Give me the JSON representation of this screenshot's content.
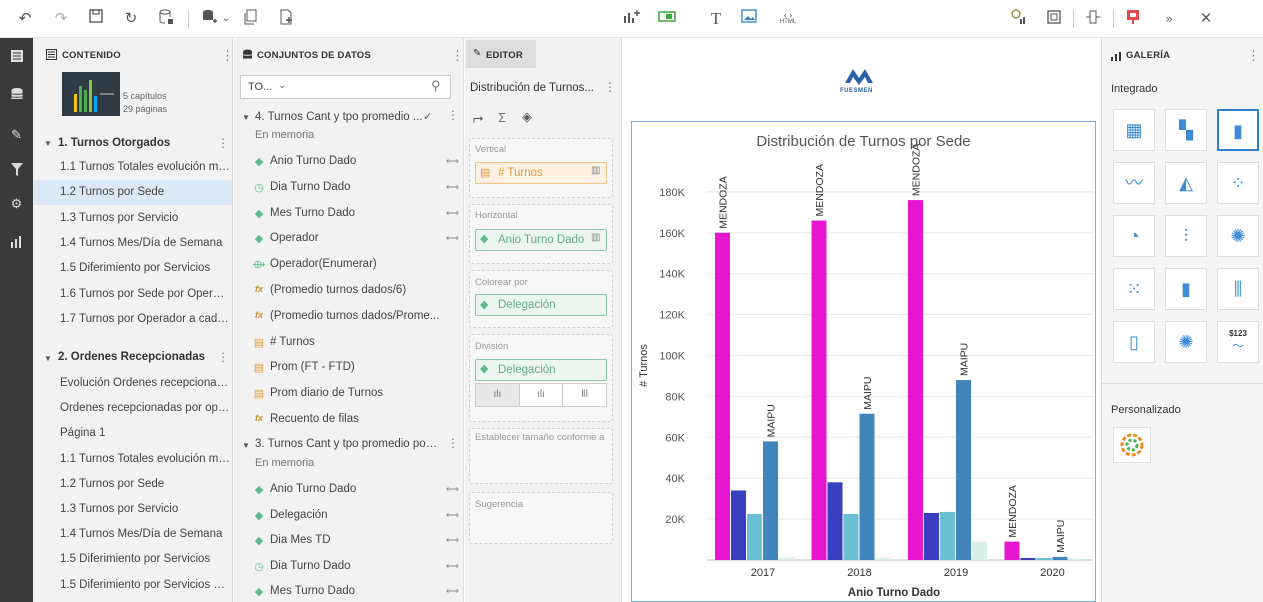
{
  "toolbar": {
    "left_icons": [
      "undo-icon",
      "redo-icon",
      "save-icon",
      "refresh-icon",
      "data-source-icon",
      "add-dataset-icon",
      "chevron-down-icon",
      "copy-icon",
      "new-page-icon"
    ],
    "center_icons": [
      "add-chart-icon",
      "add-filter-icon",
      "text-icon",
      "image-icon",
      "html-icon"
    ],
    "text_icon_glyph": "T",
    "html_icon_label": "HTML",
    "right_icons": [
      "variables-icon",
      "fit-icon",
      "expand-icon",
      "publish-icon",
      "collapse-icon",
      "close-icon"
    ],
    "close_glyph": "×"
  },
  "iconbar": {
    "items": [
      "pages-icon",
      "database-icon",
      "edit-icon",
      "filter-icon",
      "settings-icon",
      "chart-icon"
    ]
  },
  "contenido": {
    "title": "CONTENIDO",
    "summary_chapters": "5 capítulos",
    "summary_pages": "29 páginas",
    "section1": "1. Turnos Otorgados",
    "section1_items": [
      "1.1 Turnos Totales evolución me...",
      "1.2 Turnos por Sede",
      "1.3 Turnos por Servicio",
      "1.4 Turnos Mes/Día de Semana",
      "1.5 Diferimiento por Servicios",
      "1.6 Turnos por Sede por Operador",
      "1.7 Turnos por Operador a cada ..."
    ],
    "section2": "2. Ordenes Recepcionadas",
    "section2_items": [
      "Evolución Órdenes recepcionad...",
      "Ordenes recepcionadas por oper...",
      "Página 1",
      "1.1 Turnos Totales evolución me...",
      "1.2 Turnos por Sede",
      "1.3 Turnos por Servicio",
      "1.4 Turnos Mes/Día de Semana",
      "1.5 Diferimiento por Servicios",
      "1.5 Diferimiento por Servicios co..."
    ]
  },
  "datasets": {
    "title": "CONJUNTOS DE DATOS",
    "filter_value": "TO...",
    "group4": "4. Turnos Cant y tpo promedio ...",
    "group4_status": "En memoria",
    "group4_fields": [
      {
        "label": "Anio Turno Dado",
        "icon": "dimension-icon",
        "linked": true
      },
      {
        "label": "Dia Turno Dado",
        "icon": "time-icon",
        "linked": true
      },
      {
        "label": "Mes Turno Dado",
        "icon": "dimension-icon",
        "linked": true
      },
      {
        "label": "Operador",
        "icon": "dimension-icon",
        "linked": true
      },
      {
        "label": "Operador(Enumerar)",
        "icon": "enumerate-icon",
        "linked": false
      },
      {
        "label": "(Promedio turnos dados/6)",
        "icon": "formula-icon",
        "linked": false
      },
      {
        "label": "(Promedio turnos dados/Prome...",
        "icon": "formula-icon",
        "linked": false
      },
      {
        "label": "# Turnos",
        "icon": "measure-icon",
        "linked": false
      },
      {
        "label": "Prom (FT - FTD)",
        "icon": "measure-icon",
        "linked": false
      },
      {
        "label": "Prom diario de Turnos",
        "icon": "measure-icon",
        "linked": false
      },
      {
        "label": "Recuento de filas",
        "icon": "formula-icon",
        "linked": false
      }
    ],
    "group3": "3. Turnos Cant y tpo promedio por ...",
    "group3_status": "En memoria",
    "group3_fields": [
      {
        "label": "Anio Turno Dado",
        "icon": "dimension-icon",
        "linked": true
      },
      {
        "label": "Delegación",
        "icon": "dimension-icon",
        "linked": true
      },
      {
        "label": "Dia Mes TD",
        "icon": "dimension-icon",
        "linked": true
      },
      {
        "label": "Dia Turno Dado",
        "icon": "time-icon",
        "linked": true
      },
      {
        "label": "Mes Turno Dado",
        "icon": "dimension-icon",
        "linked": true
      }
    ]
  },
  "editor": {
    "tab": "EDITOR",
    "chart_name": "Distribución de Turnos...",
    "vertical_label": "Vertical",
    "vertical_chip": "# Turnos",
    "horizontal_label": "Horizontal",
    "horizontal_chip": "Anio Turno Dado",
    "color_label": "Colorear por",
    "color_chip": "Delegación",
    "division_label": "División",
    "division_chip": "Delegación",
    "size_label": "Establecer tamaño conforme a",
    "hint_label": "Sugerencia"
  },
  "canvas": {
    "logo_text": "FUESMEN",
    "colors": {
      "MENDOZA": "#e815d0",
      "c2": "#3a3fbf",
      "c3": "#6cc0d6",
      "MAIPU": "#4185bd",
      "c5": "#d9f0e8"
    }
  },
  "chart_data": {
    "type": "bar",
    "title": "Distribución de Turnos por Sede",
    "xlabel": "Anio Turno Dado",
    "ylabel": "# Turnos",
    "categories": [
      "2017",
      "2018",
      "2019",
      "2020"
    ],
    "ylim": [
      0,
      200000
    ],
    "yticks": [
      "20K",
      "40K",
      "60K",
      "80K",
      "100K",
      "120K",
      "140K",
      "160K",
      "180K"
    ],
    "grid": true,
    "series": [
      {
        "name": "MENDOZA",
        "values": [
          160000,
          166000,
          176000,
          9000
        ]
      },
      {
        "values": [
          34000,
          38000,
          23000,
          1000
        ]
      },
      {
        "values": [
          22500,
          22500,
          23500,
          1000
        ]
      },
      {
        "name": "MAIPU",
        "values": [
          58000,
          71500,
          88000,
          1500
        ]
      },
      {
        "values": [
          1200,
          1200,
          9000,
          800
        ]
      }
    ]
  },
  "gallery": {
    "title": "GALERÍA",
    "integrated_label": "Integrado",
    "tiles": [
      "table-icon",
      "pivot-icon",
      "bar-chart-icon",
      "line-chart-icon",
      "area-chart-icon",
      "scatter-icon",
      "pie-chart-icon",
      "combo-chart-icon",
      "map-icon",
      "network-icon",
      "histogram-icon",
      "boxplot-icon",
      "waterfall-icon",
      "heatmap-map-icon",
      "kpi-icon"
    ],
    "kpi_tile_text": "$123",
    "custom_label": "Personalizado",
    "custom_tiles": [
      "radial-icon"
    ]
  }
}
